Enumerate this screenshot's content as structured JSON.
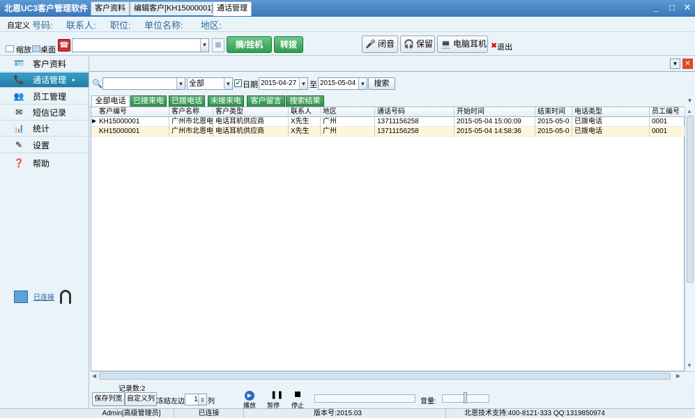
{
  "window": {
    "title": "北恩UC3客户管理软件",
    "min": "_",
    "max": "□",
    "close": "✕"
  },
  "infobar": {
    "customize": "自定义",
    "fields": [
      "号码:",
      "联系人:",
      "职位:",
      "单位名称:",
      "地区:"
    ]
  },
  "toolbar": {
    "shrink": "缩放",
    "desktop": "桌面",
    "answer": "摘/挂机",
    "transfer": "转拨",
    "mute": "闭音",
    "hold": "保留",
    "pc_headset": "电脑耳机",
    "exit": "退出",
    "number_value": ""
  },
  "sidebar": {
    "items": [
      {
        "label": "客户资料",
        "icon": "customer-icon"
      },
      {
        "label": "通话管理",
        "icon": "call-icon"
      },
      {
        "label": "员工管理",
        "icon": "staff-icon"
      },
      {
        "label": "短信记录",
        "icon": "sms-icon"
      },
      {
        "label": "统计",
        "icon": "stats-icon"
      },
      {
        "label": "设置",
        "icon": "settings-icon"
      },
      {
        "label": "帮助",
        "icon": "help-icon"
      }
    ],
    "connected": "已连接"
  },
  "tabs": [
    "客户资料",
    "编辑客户[KH15000001]",
    "通话管理"
  ],
  "filter": {
    "keyword": "",
    "scope": "全部",
    "date_label": "日期",
    "date_from": "2015-04-27",
    "to": "至",
    "date_to": "2015-05-04",
    "search": "搜索"
  },
  "subtabs": [
    "全部电话",
    "已接来电",
    "已拨电话",
    "未接来电",
    "客户留言",
    "搜索结果"
  ],
  "grid": {
    "columns": [
      "客户编号",
      "客户名称",
      "客户类型",
      "联系人",
      "地区",
      "通话号码",
      "开始时间",
      "结束时间",
      "电话类型",
      "员工编号"
    ],
    "rows": [
      [
        "KH15000001",
        "广州市北恩电",
        "电话耳机供应商",
        "X先生",
        "广州",
        "13711156258",
        "2015-05-04 15:00:09",
        "2015-05-0",
        "已拨电话",
        "0001"
      ],
      [
        "KH15000001",
        "广州市北恩电",
        "电话耳机供应商",
        "X先生",
        "广州",
        "13711156258",
        "2015-05-04 14:58:36",
        "2015-05-0",
        "已拨电话",
        "0001"
      ]
    ]
  },
  "bottom": {
    "record_count": "记录数:2",
    "save_width": "保存列宽",
    "custom_col": "自定义列",
    "freeze_left": "冻结左边",
    "freeze_value": "1",
    "col": "列",
    "play": "播放",
    "pause": "暂停",
    "stop": "停止",
    "volume": "音量:"
  },
  "status": {
    "user": "Admin[高级管理员]",
    "conn": "已连接",
    "version": "版本号:2015.03",
    "support": "北恩技术支持:400-8121-333 QQ:1319850974"
  }
}
